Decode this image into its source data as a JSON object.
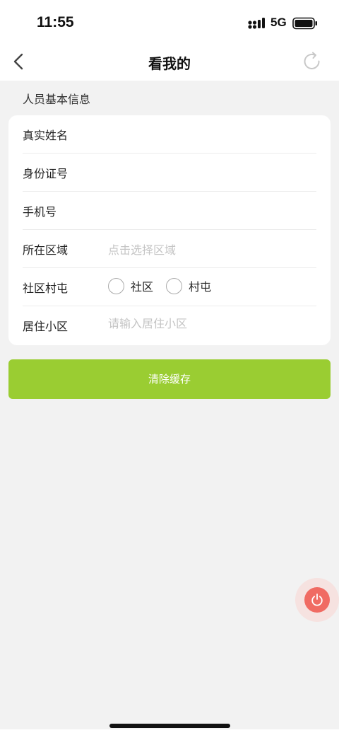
{
  "status_bar": {
    "time": "11:55",
    "network": "5G",
    "icons": [
      "signal-icon",
      "battery-icon"
    ]
  },
  "nav": {
    "title": "看我的",
    "icons": [
      "back-chevron-icon",
      "refresh-icon"
    ]
  },
  "section": {
    "title": "人员基本信息"
  },
  "form": {
    "name": {
      "label": "真实姓名",
      "value": ""
    },
    "id_number": {
      "label": "身份证号",
      "value": ""
    },
    "phone": {
      "label": "手机号",
      "value": ""
    },
    "region": {
      "label": "所在区域",
      "placeholder": "点击选择区域"
    },
    "community_type": {
      "label": "社区村屯",
      "options": [
        "社区",
        "村屯"
      ],
      "selected": null
    },
    "residence": {
      "label": "居住小区",
      "placeholder": "请输入居住小区"
    }
  },
  "actions": {
    "clear_cache_label": "清除缓存"
  },
  "fab": {
    "icon": "power-icon"
  },
  "colors": {
    "accent_green": "#9acd32",
    "fab_red": "#f06b63",
    "background": "#f2f2f2",
    "placeholder": "#c4c4c4"
  }
}
